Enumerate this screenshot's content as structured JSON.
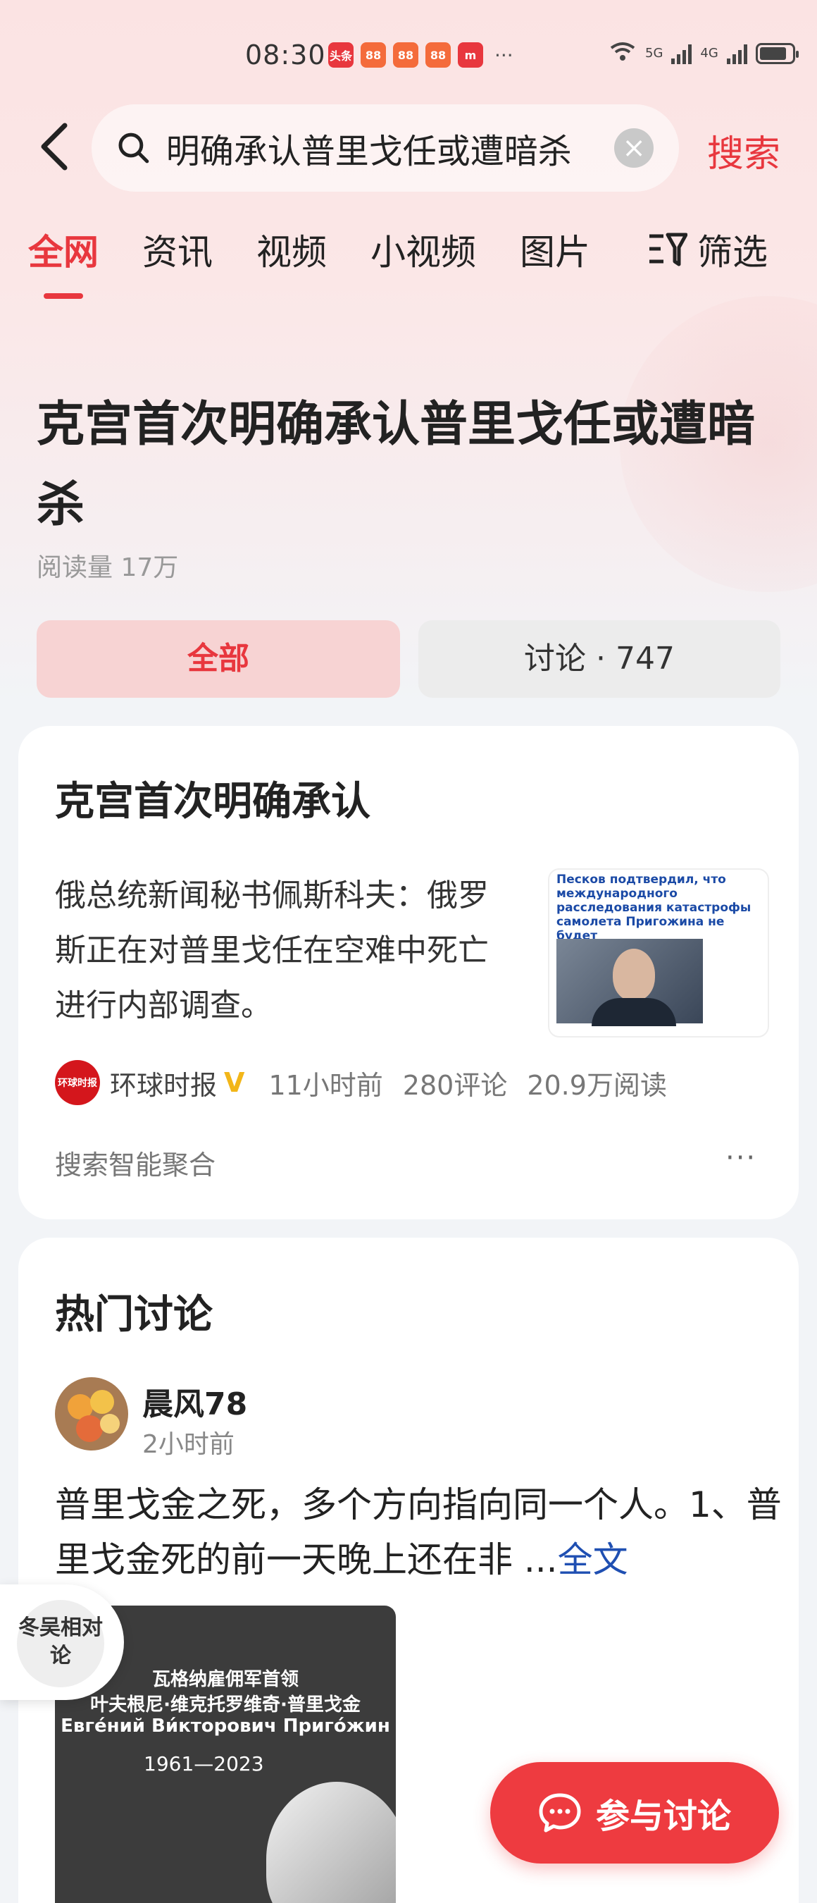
{
  "status_bar": {
    "time": "08:30",
    "app_icons": [
      {
        "label": "头条",
        "color": "#e8373e"
      },
      {
        "label": "88",
        "color": "#f46b3b"
      },
      {
        "label": "88",
        "color": "#f46b3b"
      },
      {
        "label": "88",
        "color": "#f46b3b"
      },
      {
        "label": "m",
        "color": "#e8373e"
      }
    ],
    "dots": "···",
    "net1": "5G",
    "net2": "4G"
  },
  "search": {
    "query": "明确承认普里戈任或遭暗杀",
    "submit_label": "搜索"
  },
  "tabs": [
    "全网",
    "资讯",
    "视频",
    "小视频",
    "图片"
  ],
  "tab_fade": "‘",
  "filter_label": "筛选",
  "topic": {
    "title": "克宫首次明确承认普里戈任或遭暗杀",
    "read_count": "阅读量 17万"
  },
  "segments": {
    "all": "全部",
    "discuss": "讨论 · 747"
  },
  "news_card": {
    "title": "克宫首次明确承认",
    "summary": "俄总统新闻秘书佩斯科夫：俄罗斯正在对普里戈任在空难中死亡进行内部调查。",
    "thumb_headline": "Песков подтвердил, что международного расследования катастрофы самолета Пригожина не будет",
    "source_logo_text": "环球时报",
    "source": "环球时报",
    "verified_mark": "V",
    "time": "11小时前",
    "comments": "280评论",
    "reads": "20.9万阅读",
    "footer": "搜索智能聚合",
    "more": "···"
  },
  "hot_discussion": {
    "title": "热门讨论",
    "user": "晨风78",
    "time": "2小时前",
    "text": "普里戈金之死，多个方向指向同一个人。1、普里戈金死的前一天晚上还在非 ...",
    "fulltext_label": "全文",
    "image": {
      "line1": "瓦格纳雇佣军首领",
      "line2": "叶夫根尼·维克托罗维奇·普里戈金",
      "line3": "Евге́ний Ви́кторович Приго́жин",
      "years": "1961—2023"
    }
  },
  "float_badge": "冬吴相对论",
  "join_button": "参与讨论"
}
